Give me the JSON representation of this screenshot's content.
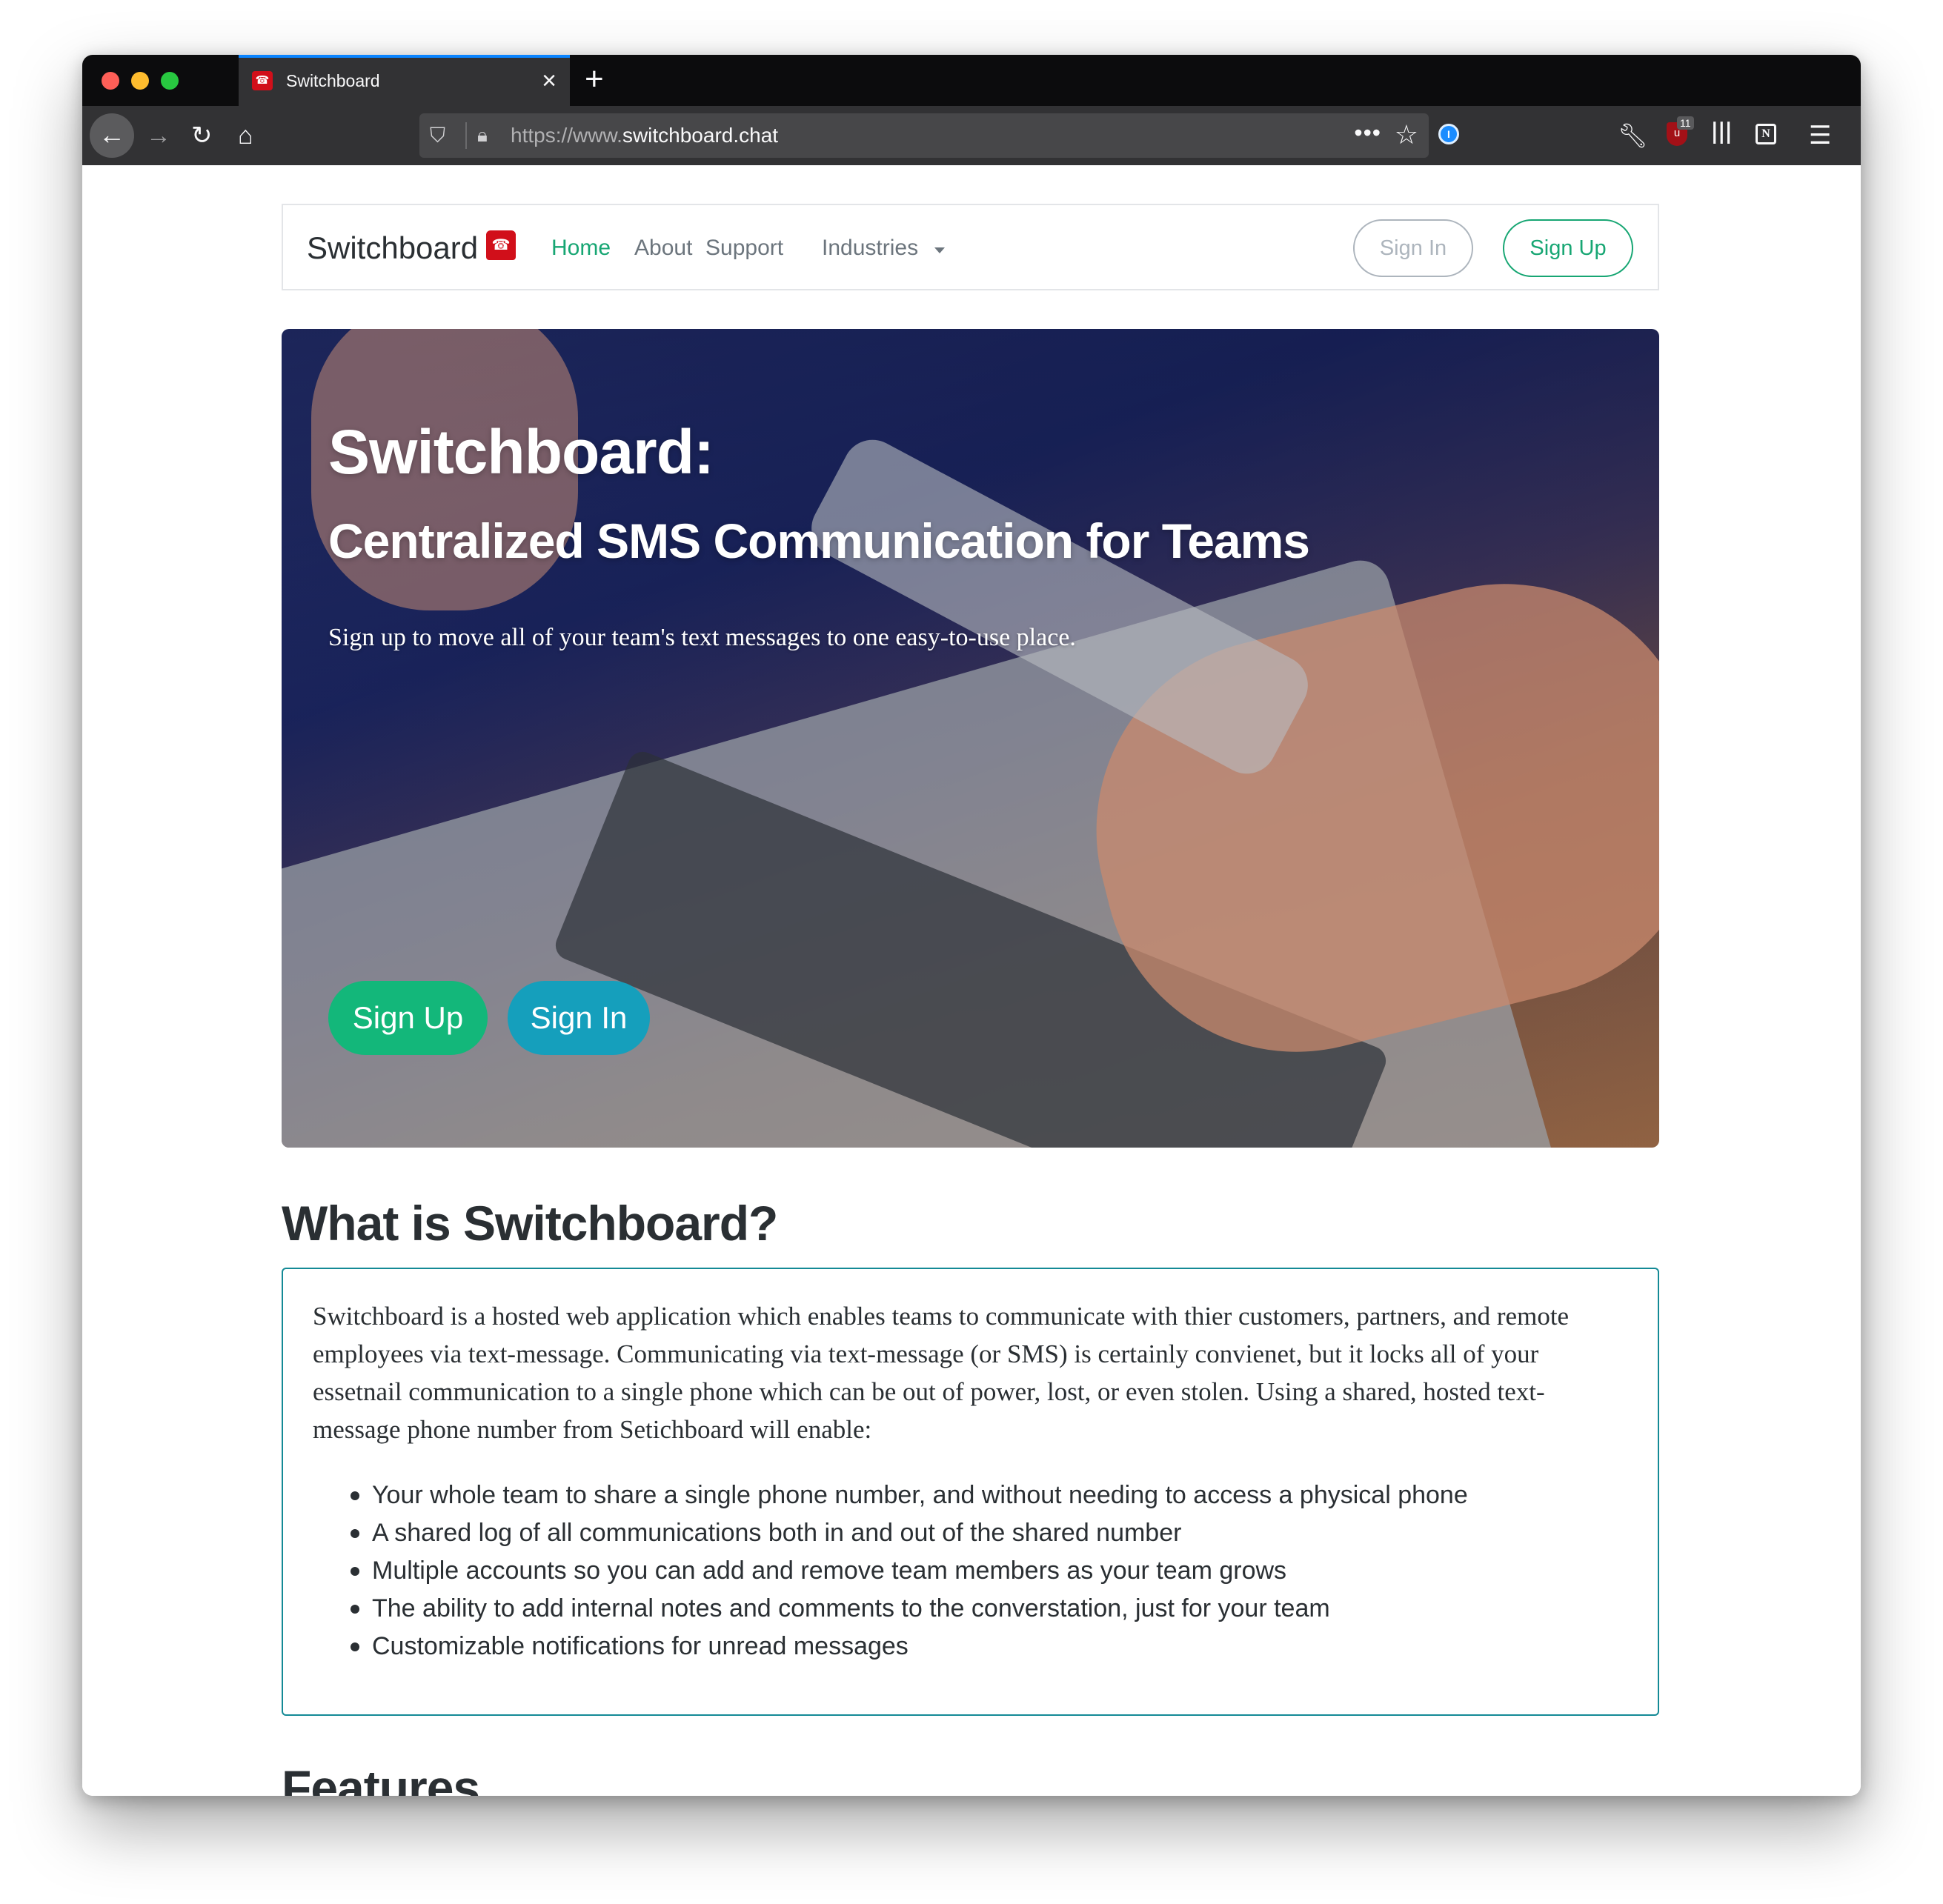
{
  "browser": {
    "tab": {
      "title": "Switchboard",
      "favicon": "telephone-icon"
    },
    "url": {
      "prefix": "https://www.",
      "domain": "switchboard.chat"
    },
    "extensions": {
      "ublock_badge": "11"
    }
  },
  "site": {
    "brand": "Switchboard",
    "nav": {
      "home": "Home",
      "about": "About",
      "support": "Support",
      "industries": "Industries"
    },
    "buttons": {
      "sign_in": "Sign In",
      "sign_up": "Sign Up"
    }
  },
  "hero": {
    "title": "Switchboard:",
    "subtitle": "Centralized SMS Communication for Teams",
    "tagline": "Sign up to move all of your team's text messages to one easy-to-use place.",
    "sign_up": "Sign Up",
    "sign_in": "Sign In"
  },
  "what": {
    "heading": "What is Switchboard?",
    "paragraph": "Switchboard is a hosted web application which enables teams to communicate with thier customers, partners, and remote employees via text-message. Communicating via text-message (or SMS) is certainly convienet, but it locks all of your essetnail communication to a single phone which can be out of power, lost, or even stolen. Using a shared, hosted text-message phone number from Setichboard will enable:",
    "bullets": [
      "Your whole team to share a single phone number, and without needing to access a physical phone",
      "A shared log of all communications both in and out of the shared number",
      "Multiple accounts so you can add and remove team members as your team grows",
      "The ability to add internal notes and comments to the converstation, just for your team",
      "Customizable notifications for unread messages"
    ]
  },
  "features": {
    "heading": "Features"
  },
  "colors": {
    "accent_green": "#17a673",
    "hero_signup": "#13b77a",
    "hero_signin": "#159fbc",
    "box_border": "#148a96"
  }
}
